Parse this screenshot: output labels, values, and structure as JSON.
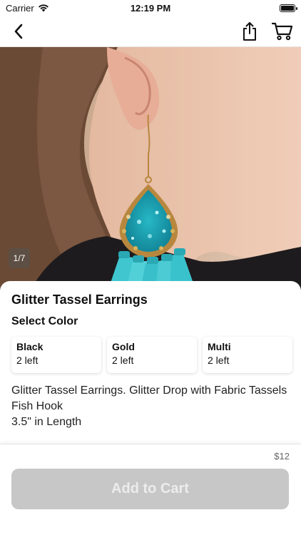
{
  "status_bar": {
    "carrier": "Carrier",
    "time": "12:19 PM"
  },
  "nav": {
    "icons": [
      "back-arrow-icon",
      "share-icon",
      "cart-icon"
    ]
  },
  "gallery": {
    "counter": "1/7"
  },
  "product": {
    "title": "Glitter Tassel Earrings",
    "select_color_label": "Select Color",
    "colors": [
      {
        "name": "Black",
        "stock": "2 left"
      },
      {
        "name": "Gold",
        "stock": "2 left"
      },
      {
        "name": "Multi",
        "stock": "2 left"
      }
    ],
    "description_lines": [
      "Glitter Tassel Earrings. Glitter Drop with Fabric Tassels",
      "Fish Hook",
      "3.5\" in Length"
    ]
  },
  "checkout": {
    "price": "$12",
    "add_to_cart_label": "Add to Cart"
  },
  "colors": {
    "button_disabled": "#c7c7c7",
    "tassel": "#3fc6cf",
    "glitter": "#1aa3b5"
  }
}
